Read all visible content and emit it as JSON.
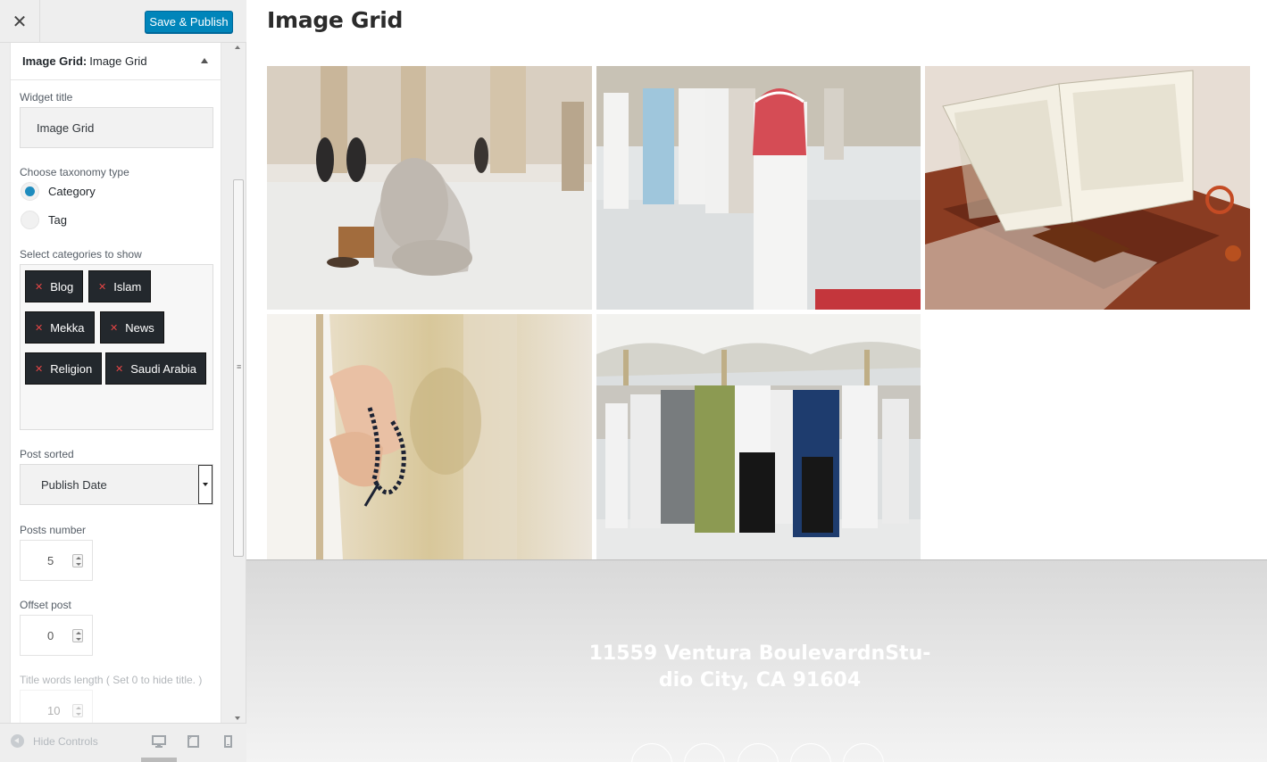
{
  "topbar": {
    "close_glyph": "✕",
    "publish_label": "Save & Publish"
  },
  "widget": {
    "header_type": "Image Grid:",
    "header_title": "Image Grid",
    "title_label": "Widget title",
    "title_value": "Image Grid",
    "taxonomy_label": "Choose taxonomy type",
    "taxonomy_options": [
      "Category",
      "Tag"
    ],
    "taxonomy_selected": "Category",
    "categories_label": "Select categories to show",
    "categories": [
      "Blog",
      "Islam",
      "Mekka",
      "News",
      "Religion",
      "Saudi Arabia"
    ],
    "sorted_label": "Post sorted",
    "sorted_value": "Publish Date",
    "posts_number_label": "Posts number",
    "posts_number_value": "5",
    "offset_label": "Offset post",
    "offset_value": "0",
    "title_words_label": "Title words length ( Set 0 to hide title. )",
    "title_words_value": "10"
  },
  "footer_controls": {
    "hide_label": "Hide Controls",
    "devices": [
      "desktop-icon",
      "tablet-icon",
      "mobile-icon"
    ]
  },
  "preview": {
    "heading": "Image Grid",
    "images": [
      "woman-sitting-mosque",
      "men-praying-red-scarf",
      "quran-on-stand",
      "prayer-beads-hand",
      "congregation-umbrellas"
    ],
    "address_line1": "11559 Ventura BoulevardnStu-",
    "address_line2": "dio City, CA 91604"
  },
  "colors": {
    "accent": "#0085ba",
    "chip": "#23282d",
    "radio": "#1e8cbe"
  }
}
